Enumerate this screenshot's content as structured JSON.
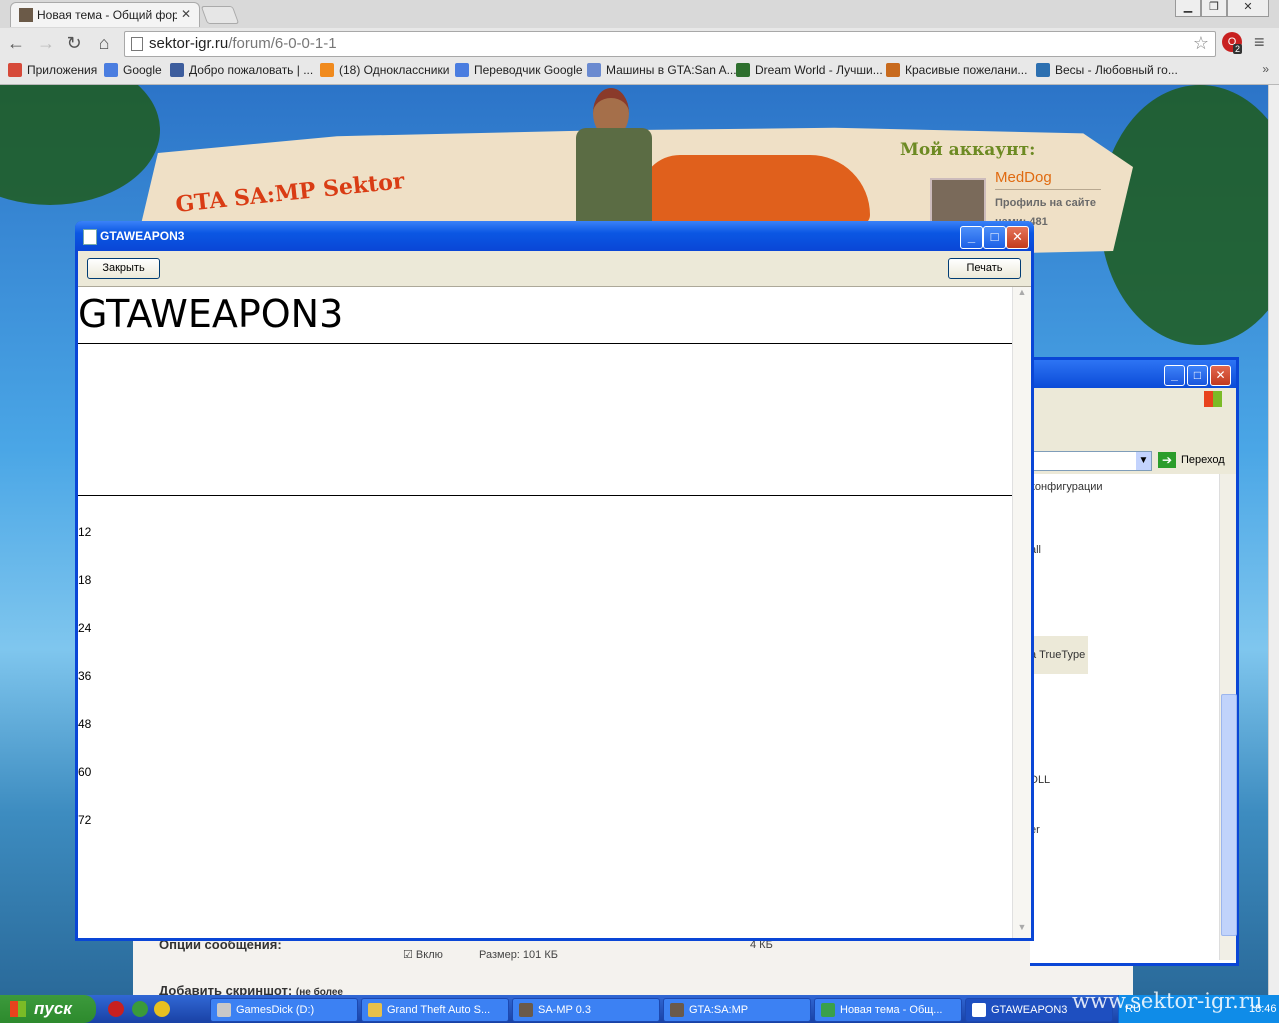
{
  "browser": {
    "tab_title": "Новая тема - Общий форум",
    "url_host": "sektor-igr.ru",
    "url_path": "/forum/6-0-0-1-1",
    "ext_badge": "2",
    "bookmarks": [
      {
        "label": "Приложения",
        "color": "#d64a3a"
      },
      {
        "label": "Google",
        "color": "#4a7de0"
      },
      {
        "label": "Добро пожаловать | ...",
        "color": "#3d5d9d"
      },
      {
        "label": "(18) Одноклассники",
        "color": "#f08a1d"
      },
      {
        "label": "Переводчик Google",
        "color": "#4a7de0"
      },
      {
        "label": "Машины в GTA:San A...",
        "color": "#6a8ad0"
      },
      {
        "label": "Dream World - Лучши...",
        "color": "#2e6f2e"
      },
      {
        "label": "Красивые пожелани...",
        "color": "#c86a1d"
      },
      {
        "label": "Весы - Любовный го...",
        "color": "#2c6fb0"
      }
    ]
  },
  "site": {
    "title": "GTA SA:MP Sektor",
    "account_title": "Мой аккаунт:",
    "username": "MedDog",
    "profile_link": "Профиль на сайте",
    "posts_label": "нами: 481",
    "form_options_label": "Опции сообщения:",
    "form_enable": "Вклю",
    "form_screenshot_label": "Добавить скриншот:",
    "form_screenshot_note": "(не более",
    "form_size_label": "Размер: 101 КБ",
    "form_kb": "4 КБ"
  },
  "explorer": {
    "go_label": "Переход",
    "items": [
      "конфигурации",
      "all",
      "а TrueType",
      "DLL",
      "er"
    ]
  },
  "font_viewer": {
    "title": "GTAWEAPON3",
    "close_label": "Закрыть",
    "print_label": "Печать",
    "font_name": "GTAWEAPON3",
    "sizes": [
      "12",
      "18",
      "24",
      "36",
      "48",
      "60",
      "72"
    ]
  },
  "taskbar": {
    "start_label": "пуск",
    "tasks": [
      {
        "label": "GamesDick (D:)",
        "color": "#c8c8c8"
      },
      {
        "label": "Grand Theft Auto S...",
        "color": "#e7c04a"
      },
      {
        "label": "SA-MP 0.3",
        "color": "#6a5a4a"
      },
      {
        "label": "GTA:SA:MP",
        "color": "#6a5a4a"
      },
      {
        "label": "Новая тема - Общ...",
        "color": "#3aa04a"
      },
      {
        "label": "GTAWEAPON3",
        "color": "#ffffff"
      }
    ],
    "lang": "RU",
    "clock": "18:46"
  },
  "watermark": "www.sektor-igr.ru"
}
